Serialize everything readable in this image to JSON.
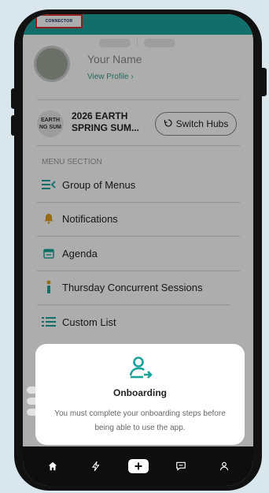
{
  "header": {
    "logo_text": "CONNECTOR"
  },
  "profile": {
    "name": "Your Name",
    "link": "View Profile ›"
  },
  "hub": {
    "logo_line1": "EARTH",
    "logo_line2": "NG SUM",
    "name": "2026 EARTH SPRING SUM...",
    "switch_label": "Switch Hubs"
  },
  "menu": {
    "section_label": "MENU SECTION",
    "items": [
      {
        "label": "Group of Menus",
        "icon": "menu-list-icon"
      },
      {
        "label": "Notifications",
        "icon": "bell-icon"
      },
      {
        "label": "Agenda",
        "icon": "calendar-icon"
      },
      {
        "label": "Thursday Concurrent Sessions",
        "icon": "info-icon"
      },
      {
        "label": "Custom List",
        "icon": "list-icon"
      }
    ]
  },
  "onboarding": {
    "title": "Onboarding",
    "body": "You must complete your onboarding steps before being able to use the app."
  },
  "nav": [
    "home-icon",
    "bolt-icon",
    "add-icon",
    "chat-icon",
    "person-icon"
  ],
  "colors": {
    "accent": "#1aa39a",
    "menu_icon": "#1aa39a",
    "bell": "#e0a020",
    "nav_bg": "#0e0e0e"
  }
}
